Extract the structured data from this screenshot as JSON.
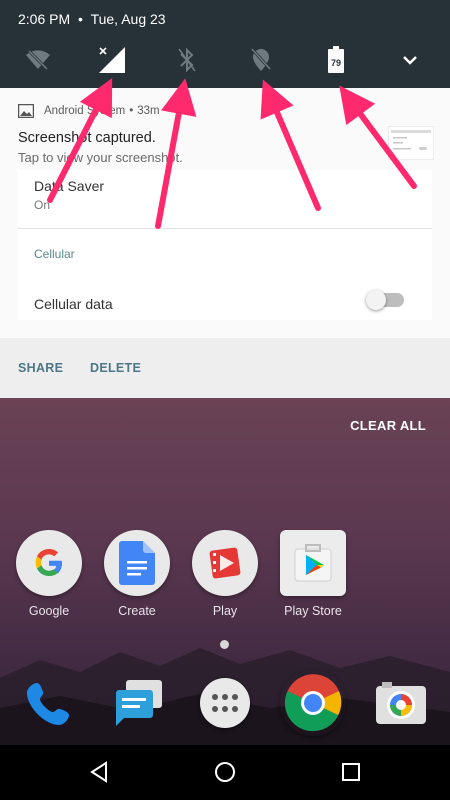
{
  "status_bar": {
    "time": "2:06 PM",
    "separator": "•",
    "date": "Tue, Aug 23"
  },
  "quick_settings": [
    {
      "name": "wifi-off-icon"
    },
    {
      "name": "cellular-signal-icon"
    },
    {
      "name": "bluetooth-off-icon"
    },
    {
      "name": "location-off-icon"
    },
    {
      "name": "battery-icon",
      "level": "79"
    },
    {
      "name": "expand-chevron-icon"
    }
  ],
  "notification": {
    "app": "Android System",
    "dot": "•",
    "age": "33m",
    "title": "Screenshot captured.",
    "subtitle": "Tap to view your screenshot.",
    "settings": {
      "data_saver_title": "Data Saver",
      "data_saver_sub": "On",
      "section": "Cellular",
      "cellular_data_label": "Cellular data",
      "cellular_data_on": false
    },
    "actions": {
      "share": "SHARE",
      "delete": "DELETE"
    }
  },
  "home": {
    "clear_all": "CLEAR ALL",
    "apps": [
      {
        "label": "Google"
      },
      {
        "label": "Create"
      },
      {
        "label": "Play"
      },
      {
        "label": "Play Store"
      }
    ],
    "dock": [
      {
        "name": "phone-app"
      },
      {
        "name": "messages-app"
      },
      {
        "name": "app-drawer"
      },
      {
        "name": "chrome-app"
      },
      {
        "name": "camera-app"
      }
    ]
  },
  "colors": {
    "shade_bg": "#263238",
    "annotation_arrow": "#ff2a6d",
    "action_text": "#4d7788"
  }
}
